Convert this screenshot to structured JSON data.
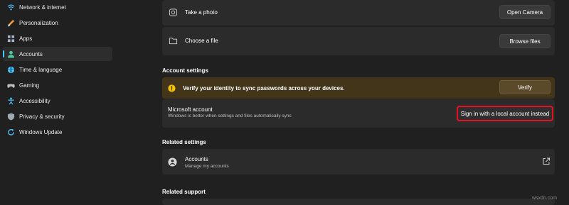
{
  "sidebar": {
    "items": [
      {
        "label": "Network & internet",
        "icon": "wifi-icon",
        "color": "#4cc2ff"
      },
      {
        "label": "Personalization",
        "icon": "brush-icon",
        "color": "#f29e38"
      },
      {
        "label": "Apps",
        "icon": "apps-icon",
        "color": "#a8b8c8"
      },
      {
        "label": "Accounts",
        "icon": "person-icon",
        "color": "#4ec9a0",
        "active": true
      },
      {
        "label": "Time & language",
        "icon": "globe-clock-icon",
        "color": "#4cc2ff"
      },
      {
        "label": "Gaming",
        "icon": "controller-icon",
        "color": "#c0c0c0"
      },
      {
        "label": "Accessibility",
        "icon": "accessibility-icon",
        "color": "#4cc2ff"
      },
      {
        "label": "Privacy & security",
        "icon": "shield-icon",
        "color": "#a0a8b0"
      },
      {
        "label": "Windows Update",
        "icon": "update-icon",
        "color": "#4cc2ff"
      }
    ]
  },
  "photo": {
    "title": "Take a photo",
    "button": "Open Camera",
    "icon": "camera-icon"
  },
  "file": {
    "title": "Choose a file",
    "button": "Browse files",
    "icon": "folder-icon"
  },
  "account_settings": {
    "header": "Account settings"
  },
  "verify": {
    "message": "Verify your identity to sync passwords across your devices.",
    "button": "Verify",
    "icon": "warning-icon",
    "background": "#433519",
    "accent": "#f5c400"
  },
  "ms_account": {
    "title": "Microsoft account",
    "subtitle": "Windows is better when settings and files automatically sync",
    "button": "Sign in with a local account instead",
    "highlight_color": "#e81123"
  },
  "related_settings": {
    "header": "Related settings",
    "accounts_title": "Accounts",
    "accounts_subtitle": "Manage my accounts",
    "icon": "person-circle-icon",
    "link_icon": "external-link-icon"
  },
  "related_support": {
    "header": "Related support"
  },
  "watermark": "wsxdn.com"
}
